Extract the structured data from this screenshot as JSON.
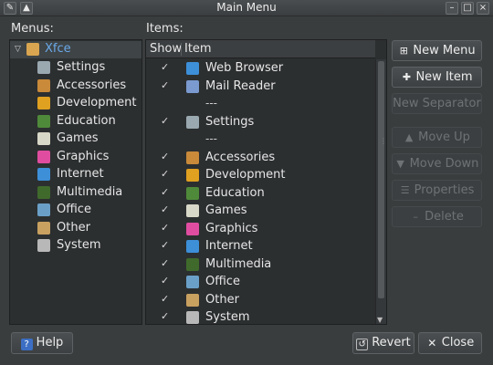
{
  "window": {
    "title": "Main Menu"
  },
  "labels": {
    "menus": "Menus:",
    "items": "Items:"
  },
  "columns": {
    "show": "Show",
    "item": "Item"
  },
  "menus": {
    "root": "Xfce",
    "children": [
      "Settings",
      "Accessories",
      "Development",
      "Education",
      "Games",
      "Graphics",
      "Internet",
      "Multimedia",
      "Office",
      "Other",
      "System"
    ]
  },
  "items": [
    {
      "show": "✓",
      "label": "Web Browser"
    },
    {
      "show": "✓",
      "label": "Mail Reader"
    },
    {
      "show": "",
      "label": "---"
    },
    {
      "show": "✓",
      "label": "Settings"
    },
    {
      "show": "",
      "label": "---"
    },
    {
      "show": "✓",
      "label": "Accessories"
    },
    {
      "show": "✓",
      "label": "Development"
    },
    {
      "show": "✓",
      "label": "Education"
    },
    {
      "show": "✓",
      "label": "Games"
    },
    {
      "show": "✓",
      "label": "Graphics"
    },
    {
      "show": "✓",
      "label": "Internet"
    },
    {
      "show": "✓",
      "label": "Multimedia"
    },
    {
      "show": "✓",
      "label": "Office"
    },
    {
      "show": "✓",
      "label": "Other"
    },
    {
      "show": "✓",
      "label": "System"
    }
  ],
  "buttons": {
    "new_menu": "New Menu",
    "new_item": "New Item",
    "new_separator": "New Separator",
    "move_up": "Move Up",
    "move_down": "Move Down",
    "properties": "Properties",
    "delete": "Delete",
    "help": "Help",
    "revert": "Revert",
    "close": "Close"
  },
  "colors": {
    "selection_text": "#6aa9ea",
    "background": "#3a3d3e",
    "panel": "#2c2f30"
  }
}
